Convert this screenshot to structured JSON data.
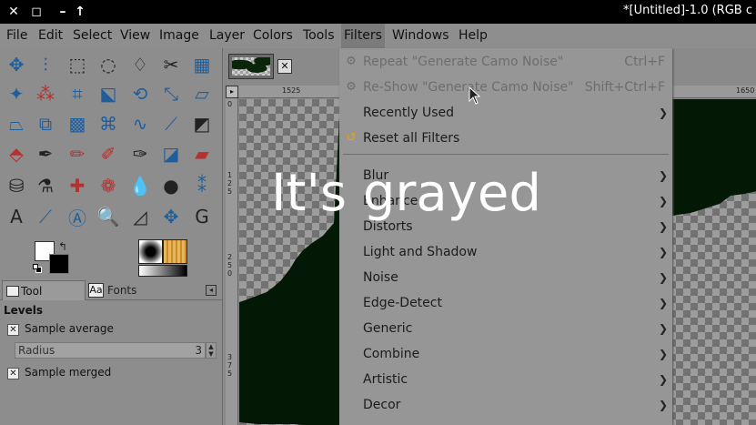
{
  "window": {
    "title": "*[Untitled]-1.0 (RGB c"
  },
  "menubar": {
    "items": [
      "File",
      "Edit",
      "Select",
      "View",
      "Image",
      "Layer",
      "Colors",
      "Tools",
      "Filters",
      "Windows",
      "Help"
    ],
    "active": "Filters"
  },
  "toolbox": {
    "tools": [
      "move-tool",
      "align-tool",
      "rect-select-tool",
      "ellipse-select-tool",
      "free-select-tool",
      "scissors-select-tool",
      "foreground-select-tool",
      "fuzzy-select-tool",
      "color-select-tool",
      "crop-tool",
      "unified-transform-tool",
      "rotate-tool",
      "scale-tool",
      "shear-tool",
      "perspective-tool",
      "flip-tool",
      "cage-tool",
      "warp-transform-tool",
      "handle-transform-tool",
      "3d-transform-tool",
      "paths-tool",
      "smudge-tool",
      "paintbrush-tool",
      "pencil-tool",
      "airbrush-tool",
      "ink-tool",
      "mypaint-brush-tool",
      "eraser-tool",
      "bucket-fill-tool",
      "clone-tool",
      "heal-tool",
      "perspective-clone-tool",
      "dodge-burn-tool",
      "bucket-tool",
      "color-picker-tool",
      "text-tool",
      "measure-tool",
      "zoom-tool-a",
      "zoom-tool",
      "levels-tool",
      "move-canvas-tool",
      "gegl-tool"
    ]
  },
  "dock": {
    "tabs": [
      "Tool Options",
      "Fonts"
    ],
    "fonts_icon": "Aa"
  },
  "tool_options": {
    "title": "Levels",
    "sample_average_label": "Sample average",
    "radius_label": "Radius",
    "radius_value": "3",
    "sample_merged_label": "Sample merged"
  },
  "rulers": {
    "h_labels": [
      "1525",
      "1650"
    ],
    "v_labels": [
      "0",
      "125",
      "250",
      "375"
    ]
  },
  "filters_menu": {
    "items": [
      {
        "label": "Repeat \"Generate Camo Noise\"",
        "shortcut": "Ctrl+F",
        "disabled": true,
        "icon": "repeat-icon"
      },
      {
        "label": "Re-Show \"Generate Camo Noise\"",
        "shortcut": "Shift+Ctrl+F",
        "disabled": true,
        "icon": "reshow-icon"
      },
      {
        "label": "Recently Used",
        "submenu": true
      },
      {
        "label": "Reset all Filters",
        "icon": "reset-icon"
      },
      {
        "label": "Blur",
        "submenu": true
      },
      {
        "label": "Enhance",
        "submenu": true
      },
      {
        "label": "Distorts",
        "submenu": true
      },
      {
        "label": "Light and Shadow",
        "submenu": true
      },
      {
        "label": "Noise",
        "submenu": true
      },
      {
        "label": "Edge-Detect",
        "submenu": true
      },
      {
        "label": "Generic",
        "submenu": true
      },
      {
        "label": "Combine",
        "submenu": true
      },
      {
        "label": "Artistic",
        "submenu": true
      },
      {
        "label": "Decor",
        "submenu": true
      }
    ]
  },
  "overlay": {
    "caption": "It's grayed"
  },
  "colors": {
    "camo": "#041806",
    "menu_bg": "#969696",
    "disabled_text": "#6d6d6d"
  }
}
